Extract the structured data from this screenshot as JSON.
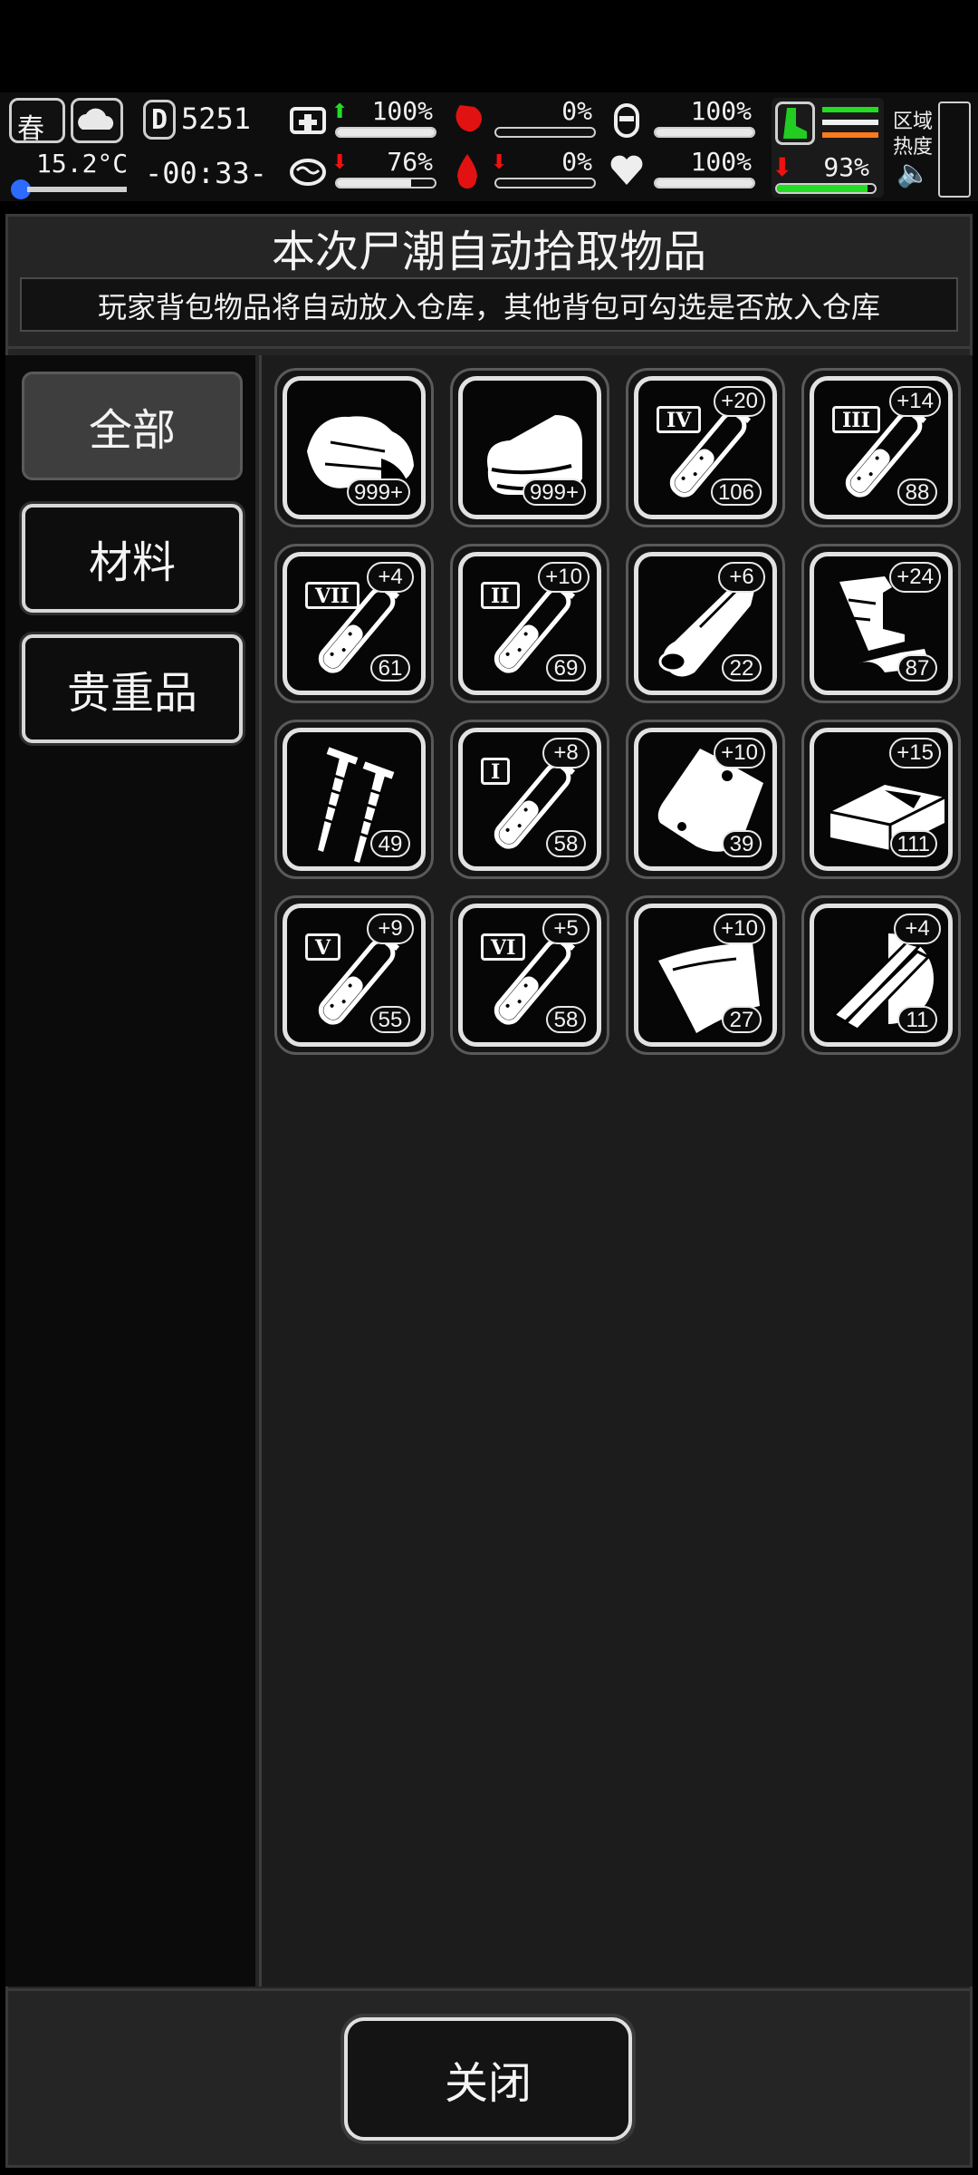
{
  "hud": {
    "season": "春",
    "temperature": "15.2°C",
    "day": "5251",
    "time": "-00:33-",
    "stats": [
      {
        "name": "health",
        "value": "100%",
        "fill": 1.0,
        "trend": "up"
      },
      {
        "name": "hunger",
        "value": "0%",
        "fill": 0.0,
        "trend": ""
      },
      {
        "name": "armor",
        "value": "100%",
        "fill": 1.0,
        "trend": ""
      },
      {
        "name": "sanity",
        "value": "76%",
        "fill": 0.76,
        "trend": "down"
      },
      {
        "name": "bleed",
        "value": "0%",
        "fill": 0.0,
        "trend": "down"
      },
      {
        "name": "mood",
        "value": "100%",
        "fill": 1.0,
        "trend": ""
      }
    ],
    "stamina": {
      "value": "93%",
      "fill": 0.93,
      "trend": "down"
    },
    "zone_label_1": "区域",
    "zone_label_2": "热度",
    "colors": {
      "up": "#22dd22",
      "down": "#ee1111",
      "stamina": "#22dd22",
      "boot": "#22cc22",
      "stripe_orange": "#ff7a1a"
    }
  },
  "dialog": {
    "title": "本次尸潮自动拾取物品",
    "subtitle": "玩家背包物品将自动放入仓库，其他背包可勾选是否放入仓库",
    "close_label": "关闭"
  },
  "tabs": [
    {
      "label": "全部",
      "active": true
    },
    {
      "label": "材料",
      "active": false
    },
    {
      "label": "贵重品",
      "active": false
    }
  ],
  "items": [
    {
      "icon": "cloth-pile-icon",
      "count": "999+",
      "bonus": "",
      "roman": ""
    },
    {
      "icon": "folded-cloth-icon",
      "count": "999+",
      "bonus": "",
      "roman": ""
    },
    {
      "icon": "vial-icon",
      "count": "106",
      "bonus": "+20",
      "roman": "IV"
    },
    {
      "icon": "vial-icon",
      "count": "88",
      "bonus": "+14",
      "roman": "III"
    },
    {
      "icon": "vial-icon",
      "count": "61",
      "bonus": "+4",
      "roman": "VII"
    },
    {
      "icon": "vial-icon",
      "count": "69",
      "bonus": "+10",
      "roman": "II"
    },
    {
      "icon": "wood-log-icon",
      "count": "22",
      "bonus": "+6",
      "roman": ""
    },
    {
      "icon": "scrap-metal-icon",
      "count": "87",
      "bonus": "+24",
      "roman": ""
    },
    {
      "icon": "screws-icon",
      "count": "49",
      "bonus": "",
      "roman": ""
    },
    {
      "icon": "vial-icon",
      "count": "58",
      "bonus": "+8",
      "roman": "I"
    },
    {
      "icon": "leather-pouch-icon",
      "count": "39",
      "bonus": "+10",
      "roman": ""
    },
    {
      "icon": "brick-icon",
      "count": "111",
      "bonus": "+15",
      "roman": ""
    },
    {
      "icon": "vial-icon",
      "count": "55",
      "bonus": "+9",
      "roman": "V"
    },
    {
      "icon": "vial-icon",
      "count": "58",
      "bonus": "+5",
      "roman": "VI"
    },
    {
      "icon": "fabric-sheet-icon",
      "count": "27",
      "bonus": "+10",
      "roman": ""
    },
    {
      "icon": "wood-planks-icon",
      "count": "11",
      "bonus": "+4",
      "roman": ""
    }
  ]
}
